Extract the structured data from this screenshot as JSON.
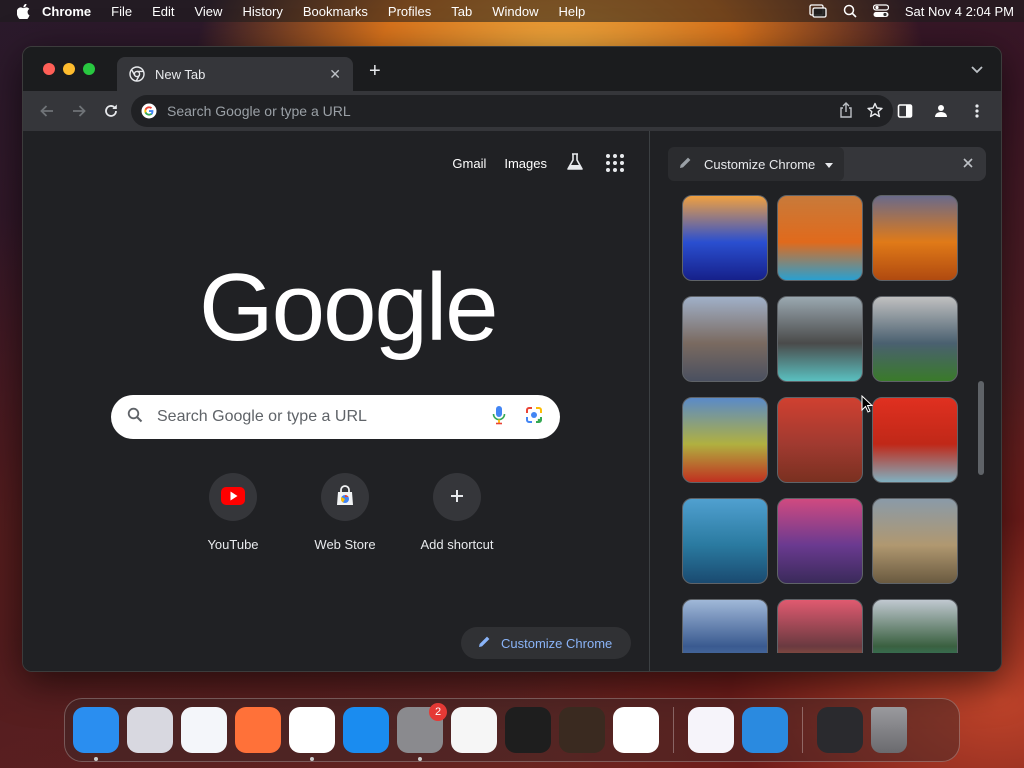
{
  "menubar": {
    "app_name": "Chrome",
    "items": [
      "File",
      "Edit",
      "View",
      "History",
      "Bookmarks",
      "Profiles",
      "Tab",
      "Window",
      "Help"
    ],
    "clock": "Sat Nov 4  2:04 PM"
  },
  "tab": {
    "title": "New Tab"
  },
  "omnibox": {
    "placeholder": "Search Google or type a URL"
  },
  "ntp": {
    "links": {
      "gmail": "Gmail",
      "images": "Images"
    },
    "logo_text": "Google",
    "search_placeholder": "Search Google or type a URL",
    "shortcuts": [
      {
        "label": "YouTube",
        "icon": "youtube-icon"
      },
      {
        "label": "Web Store",
        "icon": "web-store-icon"
      },
      {
        "label": "Add shortcut",
        "icon": "plus-icon"
      }
    ],
    "customize_label": "Customize Chrome"
  },
  "sidepanel": {
    "title": "Customize Chrome",
    "thumbnails": [
      {
        "name": "blue-dunes",
        "colors": [
          "#f0a040",
          "#2a4fd0",
          "#16208a"
        ]
      },
      {
        "name": "hot-spring",
        "colors": [
          "#c87a3a",
          "#e06a1c",
          "#2aa0d0"
        ]
      },
      {
        "name": "autumn-forest",
        "colors": [
          "#6a6a8a",
          "#e07a18",
          "#b04a10"
        ]
      },
      {
        "name": "rocky-peaks",
        "colors": [
          "#a0b0c8",
          "#7a6a60",
          "#4a5060"
        ]
      },
      {
        "name": "waterfall",
        "colors": [
          "#9aa8b0",
          "#4a4a4a",
          "#5ac0c0"
        ]
      },
      {
        "name": "mountain-meadow",
        "colors": [
          "#c0c0c0",
          "#4a6070",
          "#3a7a2a"
        ]
      },
      {
        "name": "poppy-field",
        "colors": [
          "#5a8ac8",
          "#b0b040",
          "#c03020"
        ]
      },
      {
        "name": "red-mountains",
        "colors": [
          "#d04030",
          "#a03a30",
          "#7a3020"
        ]
      },
      {
        "name": "red-wetland",
        "colors": [
          "#e03020",
          "#c02818",
          "#80b0c0"
        ]
      },
      {
        "name": "ice-cave",
        "colors": [
          "#50a0d0",
          "#2a7aa0",
          "#1a4a70"
        ]
      },
      {
        "name": "purple-peaks",
        "colors": [
          "#d04a80",
          "#6a3a90",
          "#3a2a5a"
        ]
      },
      {
        "name": "canyon-falls",
        "colors": [
          "#8a9aa8",
          "#b09870",
          "#6a5a40"
        ]
      },
      {
        "name": "fuji",
        "colors": [
          "#a0b8d8",
          "#3a5a90",
          "#6a90c0"
        ]
      },
      {
        "name": "sea-stacks",
        "colors": [
          "#e05a70",
          "#6a3a40",
          "#d08040"
        ]
      },
      {
        "name": "alpine-lake",
        "colors": [
          "#c0c8d0",
          "#3a6040",
          "#30a090"
        ]
      }
    ]
  },
  "dock": {
    "apps": [
      {
        "name": "finder",
        "bg": "#2a8ef0"
      },
      {
        "name": "launchpad",
        "bg": "#d8d8e0"
      },
      {
        "name": "safari",
        "bg": "#f4f6fa"
      },
      {
        "name": "firefox",
        "bg": "#ff7139"
      },
      {
        "name": "chrome",
        "bg": "#ffffff"
      },
      {
        "name": "app-store",
        "bg": "#1a8cf0"
      },
      {
        "name": "system-settings",
        "bg": "#8a8a8e",
        "badge": "2"
      },
      {
        "name": "textedit",
        "bg": "#f6f6f6"
      },
      {
        "name": "terminal",
        "bg": "#1e1e1e"
      },
      {
        "name": "garageband",
        "bg": "#3a2a20"
      },
      {
        "name": "vscode",
        "bg": "#ffffff"
      },
      {
        "name": "visual-studio",
        "bg": "#f6f4fa"
      },
      {
        "name": "weather",
        "bg": "#2a8ae0"
      }
    ]
  }
}
